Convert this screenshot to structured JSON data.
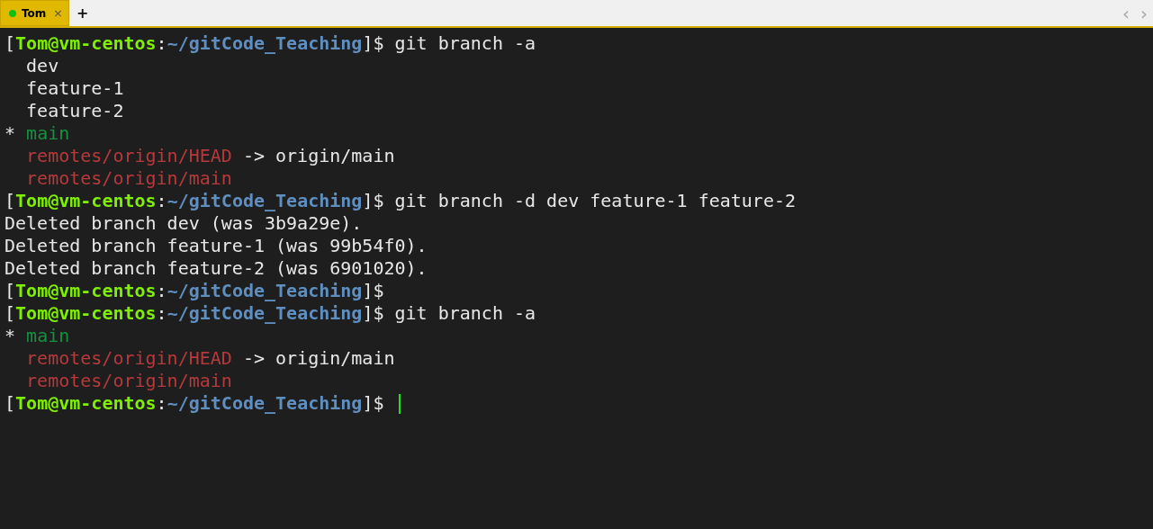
{
  "tabs": [
    {
      "label": "Tom",
      "selected": true,
      "connected": true,
      "close": "×"
    }
  ],
  "new_tab": "+",
  "nav": {
    "prev": "‹",
    "next": "›"
  },
  "terminal": {
    "lines": [
      {
        "segments": [
          {
            "kind": "punct",
            "text": "["
          },
          {
            "kind": "user",
            "text": "Tom@vm-centos"
          },
          {
            "kind": "punct",
            "text": ":"
          },
          {
            "kind": "path",
            "text": "~/gitCode_Teaching"
          },
          {
            "kind": "punct",
            "text": "]$ git branch -a"
          }
        ]
      },
      {
        "segments": [
          {
            "kind": "plain",
            "text": "  dev"
          }
        ]
      },
      {
        "segments": [
          {
            "kind": "plain",
            "text": "  feature-1"
          }
        ]
      },
      {
        "segments": [
          {
            "kind": "plain",
            "text": "  feature-2"
          }
        ]
      },
      {
        "segments": [
          {
            "kind": "plain",
            "text": "* "
          },
          {
            "kind": "current",
            "text": "main"
          }
        ]
      },
      {
        "segments": [
          {
            "kind": "remote",
            "text": "  remotes/origin/HEAD"
          },
          {
            "kind": "plain",
            "text": " -> origin/main"
          }
        ]
      },
      {
        "segments": [
          {
            "kind": "remote",
            "text": "  remotes/origin/main"
          }
        ]
      },
      {
        "segments": [
          {
            "kind": "punct",
            "text": "["
          },
          {
            "kind": "user",
            "text": "Tom@vm-centos"
          },
          {
            "kind": "punct",
            "text": ":"
          },
          {
            "kind": "path",
            "text": "~/gitCode_Teaching"
          },
          {
            "kind": "punct",
            "text": "]$ git branch -d dev feature-1 feature-2"
          }
        ]
      },
      {
        "segments": [
          {
            "kind": "plain",
            "text": "Deleted branch dev (was 3b9a29e)."
          }
        ]
      },
      {
        "segments": [
          {
            "kind": "plain",
            "text": "Deleted branch feature-1 (was 99b54f0)."
          }
        ]
      },
      {
        "segments": [
          {
            "kind": "plain",
            "text": "Deleted branch feature-2 (was 6901020)."
          }
        ]
      },
      {
        "segments": [
          {
            "kind": "punct",
            "text": "["
          },
          {
            "kind": "user",
            "text": "Tom@vm-centos"
          },
          {
            "kind": "punct",
            "text": ":"
          },
          {
            "kind": "path",
            "text": "~/gitCode_Teaching"
          },
          {
            "kind": "punct",
            "text": "]$"
          }
        ]
      },
      {
        "segments": [
          {
            "kind": "punct",
            "text": "["
          },
          {
            "kind": "user",
            "text": "Tom@vm-centos"
          },
          {
            "kind": "punct",
            "text": ":"
          },
          {
            "kind": "path",
            "text": "~/gitCode_Teaching"
          },
          {
            "kind": "punct",
            "text": "]$ git branch -a"
          }
        ]
      },
      {
        "segments": [
          {
            "kind": "plain",
            "text": "* "
          },
          {
            "kind": "current",
            "text": "main"
          }
        ]
      },
      {
        "segments": [
          {
            "kind": "remote",
            "text": "  remotes/origin/HEAD"
          },
          {
            "kind": "plain",
            "text": " -> origin/main"
          }
        ]
      },
      {
        "segments": [
          {
            "kind": "remote",
            "text": "  remotes/origin/main"
          }
        ]
      },
      {
        "cursor": true,
        "segments": [
          {
            "kind": "punct",
            "text": "["
          },
          {
            "kind": "user",
            "text": "Tom@vm-centos"
          },
          {
            "kind": "punct",
            "text": ":"
          },
          {
            "kind": "path",
            "text": "~/gitCode_Teaching"
          },
          {
            "kind": "punct",
            "text": "]$ "
          }
        ]
      }
    ]
  }
}
